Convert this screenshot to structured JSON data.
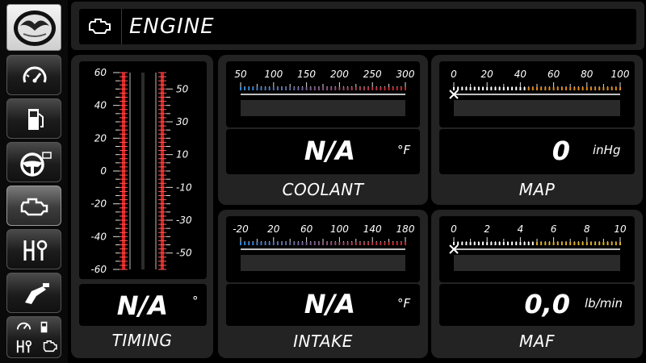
{
  "header": {
    "title": "ENGINE",
    "icon": "engine-icon"
  },
  "sidebar": {
    "logo": "brand-logo",
    "items": [
      {
        "name": "gauges",
        "icon": "speedometer-icon",
        "active": false
      },
      {
        "name": "fuel",
        "icon": "fuel-pump-icon",
        "active": false
      },
      {
        "name": "driving",
        "icon": "steering-wheel-icon",
        "active": false
      },
      {
        "name": "engine",
        "icon": "engine-icon",
        "active": true
      },
      {
        "name": "transmission",
        "icon": "gear-shift-icon",
        "active": false
      },
      {
        "name": "refuel",
        "icon": "fuel-nozzle-icon",
        "active": false
      },
      {
        "name": "overview",
        "icon": "overview-icon",
        "active": false
      }
    ]
  },
  "panels": {
    "timing": {
      "label": "TIMING",
      "value": "N/A",
      "unit": "°",
      "left_scale": [
        "60",
        "40",
        "20",
        "0",
        "-20",
        "-40",
        "-60"
      ],
      "right_scale": [
        "50",
        "30",
        "10",
        "-10",
        "-30",
        "-50"
      ]
    },
    "coolant": {
      "label": "COOLANT",
      "value": "N/A",
      "unit": "°F",
      "scale": [
        "50",
        "100",
        "150",
        "200",
        "250",
        "300"
      ]
    },
    "map": {
      "label": "MAP",
      "value": "0",
      "unit": "inHg",
      "scale": [
        "0",
        "20",
        "40",
        "60",
        "80",
        "100"
      ]
    },
    "intake": {
      "label": "INTAKE",
      "value": "N/A",
      "unit": "°F",
      "scale": [
        "-20",
        "20",
        "60",
        "100",
        "140",
        "180"
      ]
    },
    "maf": {
      "label": "MAF",
      "value": "0,0",
      "unit": "lb/min",
      "scale": [
        "0",
        "2",
        "4",
        "6",
        "8",
        "10"
      ]
    }
  },
  "colors": {
    "cold": "#2f86d8",
    "hot": "#d42020",
    "amber": "#e08a1a",
    "yellow": "#e0b020"
  }
}
